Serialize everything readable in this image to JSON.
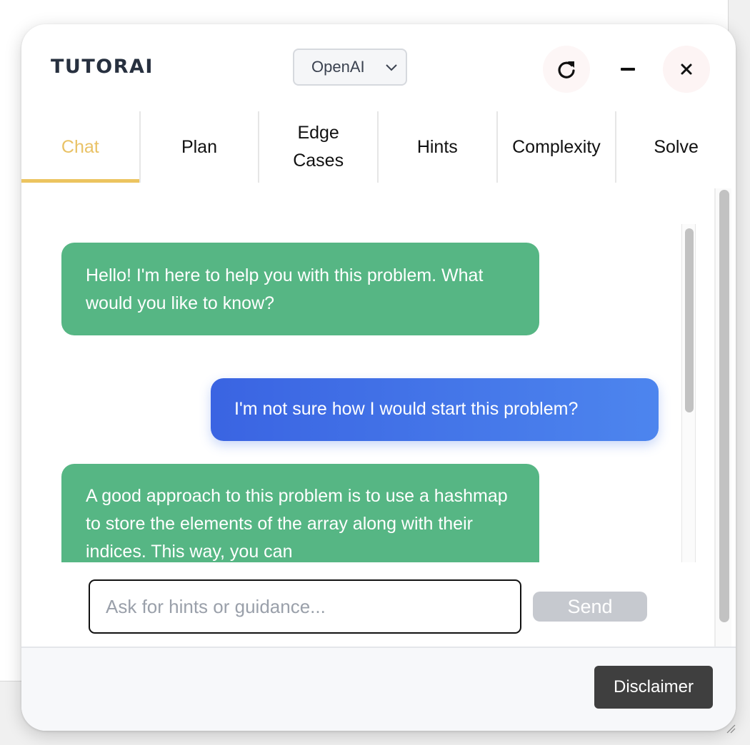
{
  "header": {
    "brand": "TUTORAI",
    "provider_select": {
      "selected": "OpenAI"
    },
    "buttons": {
      "refresh_icon": "refresh-icon",
      "minimize_icon": "minus-icon",
      "close_icon": "close-icon"
    }
  },
  "tabs": [
    {
      "label": "Chat",
      "active": true
    },
    {
      "label": "Plan",
      "active": false
    },
    {
      "label": "Edge Cases",
      "active": false
    },
    {
      "label": "Hints",
      "active": false
    },
    {
      "label": "Complexity",
      "active": false
    },
    {
      "label": "Solve",
      "active": false
    }
  ],
  "chat": {
    "messages": [
      {
        "role": "assistant",
        "text": "Hello! I'm here to help you with this problem. What would you like to know?"
      },
      {
        "role": "user",
        "text": "I'm not sure how I would start this problem?"
      },
      {
        "role": "assistant",
        "text": "A good approach to this problem is to use a hashmap to store the elements of the array along with their indices. This way, you can"
      }
    ],
    "input": {
      "placeholder": "Ask for hints or guidance...",
      "value": ""
    },
    "send_label": "Send"
  },
  "footer": {
    "disclaimer_label": "Disclaimer"
  },
  "colors": {
    "accent_active_tab": "#ecc460",
    "assistant_bubble": "#56b684",
    "user_bubble": "#3a64e2",
    "send_disabled": "#c6c9cf",
    "disclaimer_bg": "#3f3f3f",
    "brand_text": "#27303f"
  }
}
